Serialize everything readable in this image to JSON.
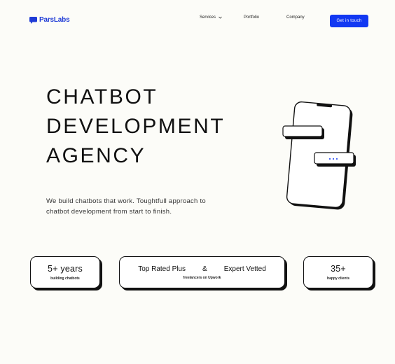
{
  "header": {
    "logo_text": "ParsLabs",
    "nav": {
      "services": "Services",
      "portfolio": "Portfolio",
      "company": "Company"
    },
    "cta": "Get in touch"
  },
  "hero": {
    "title_lines": [
      "CHATBOT",
      "DEVELOPMENT",
      "AGENCY"
    ],
    "description": "We build chatbots that work. Toughtfull approach to chatbot development from start to finish."
  },
  "stats": [
    {
      "value": "5+ years",
      "label": "building chatbots"
    },
    {
      "value_left": "Top Rated Plus",
      "amp": "&",
      "value_right": "Expert Vetted",
      "label": "freelancers on Upwork"
    },
    {
      "value": "35+",
      "label": "happy clients"
    }
  ],
  "colors": {
    "accent": "#1238f2",
    "background": "#fcfcf8",
    "text": "#111111"
  },
  "icons": {
    "logo": "chat-bubble-icon",
    "dropdown": "chevron-down-icon",
    "illustration": "phone-with-chat-bubbles"
  }
}
